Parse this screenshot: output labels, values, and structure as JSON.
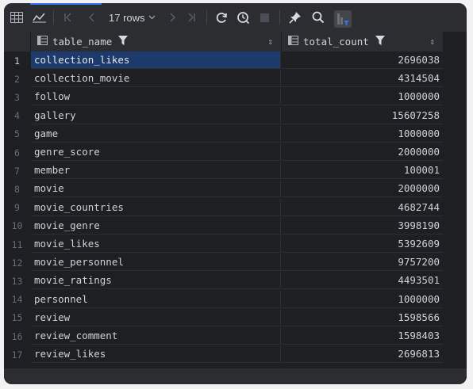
{
  "toolbar": {
    "rows_label": "17 rows",
    "icons": [
      "table-view-icon",
      "chart-view-icon",
      "first-page-icon",
      "prev-page-icon",
      "next-page-icon",
      "last-page-icon",
      "reload-icon",
      "history-icon",
      "stop-icon",
      "pin-icon",
      "search-icon",
      "filter-toggle-icon"
    ]
  },
  "columns": [
    {
      "label": "table_name"
    },
    {
      "label": "total_count"
    }
  ],
  "rows": [
    {
      "num": "1",
      "name": "collection_likes",
      "count": "2696038"
    },
    {
      "num": "2",
      "name": "collection_movie",
      "count": "4314504"
    },
    {
      "num": "3",
      "name": "follow",
      "count": "1000000"
    },
    {
      "num": "4",
      "name": "gallery",
      "count": "15607258"
    },
    {
      "num": "5",
      "name": "game",
      "count": "1000000"
    },
    {
      "num": "6",
      "name": "genre_score",
      "count": "2000000"
    },
    {
      "num": "7",
      "name": "member",
      "count": "100001"
    },
    {
      "num": "8",
      "name": "movie",
      "count": "2000000"
    },
    {
      "num": "9",
      "name": "movie_countries",
      "count": "4682744"
    },
    {
      "num": "10",
      "name": "movie_genre",
      "count": "3998190"
    },
    {
      "num": "11",
      "name": "movie_likes",
      "count": "5392609"
    },
    {
      "num": "12",
      "name": "movie_personnel",
      "count": "9757200"
    },
    {
      "num": "13",
      "name": "movie_ratings",
      "count": "4493501"
    },
    {
      "num": "14",
      "name": "personnel",
      "count": "1000000"
    },
    {
      "num": "15",
      "name": "review",
      "count": "1598566"
    },
    {
      "num": "16",
      "name": "review_comment",
      "count": "1598403"
    },
    {
      "num": "17",
      "name": "review_likes",
      "count": "2696813"
    }
  ],
  "selected_row": "1",
  "colors": {
    "accent": "#3574f0",
    "selection": "#1c3a6b",
    "background": "#1e1f22",
    "toolbar": "#2b2d30"
  }
}
